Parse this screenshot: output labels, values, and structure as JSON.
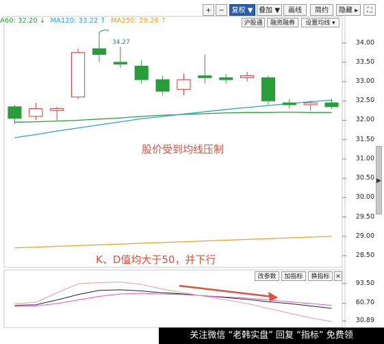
{
  "toolbar": {
    "plus": "+",
    "minus": "−",
    "fq": "复权 ▼",
    "add": "叠加 ▼",
    "draw": "画线",
    "simple": "简约",
    "hide": "隐藏 ▸",
    "expand": "⛶"
  },
  "legend": {
    "ma60": "A60: 32.20 ↓",
    "ma120": "MA120: 33.22 ↑",
    "ma250": "MA250: 29.26 ↑"
  },
  "sub_toolbar": {
    "hgt": "沪股通",
    "margin": "融资融券",
    "set_ma": "设置均线 ▾",
    "change_param": "改参数",
    "add_ind": "加指标",
    "switch_ind": "换指标",
    "close": "✕"
  },
  "annotations": {
    "price_note": "股价受到均线压制",
    "kd_note": "K、D值均大于50，并下行",
    "high_label": "34.27"
  },
  "watermark": "关注微信 “老韩实盘” 回复 “指标” 免费领",
  "colors": {
    "ma60": "#2a9d3b",
    "ma120": "#2aa0d8",
    "ma250": "#f0a020",
    "down_candle": "#2a9d3b",
    "up_candle": "#d83a3a",
    "annotation": "#e0503a"
  },
  "chart_data": [
    {
      "type": "candlestick",
      "y_ticks": [
        "34.00",
        "33.50",
        "33.00",
        "32.50",
        "32.00",
        "31.50",
        "31.00",
        "30.50",
        "30.00",
        "29.50",
        "29.00",
        "28.50"
      ],
      "ylim": [
        28.2,
        34.4
      ],
      "candles": [
        {
          "o": 32.35,
          "c": 32.05,
          "h": 32.4,
          "l": 31.9
        },
        {
          "o": 32.1,
          "c": 32.3,
          "h": 32.45,
          "l": 32.0
        },
        {
          "o": 32.25,
          "c": 32.3,
          "h": 32.35,
          "l": 32.0
        },
        {
          "o": 32.6,
          "c": 33.75,
          "h": 33.85,
          "l": 32.55
        },
        {
          "o": 33.85,
          "c": 33.7,
          "h": 34.27,
          "l": 33.5
        },
        {
          "o": 33.5,
          "c": 33.45,
          "h": 33.9,
          "l": 33.35
        },
        {
          "o": 33.4,
          "c": 33.05,
          "h": 33.55,
          "l": 32.95
        },
        {
          "o": 33.05,
          "c": 32.75,
          "h": 33.15,
          "l": 32.65
        },
        {
          "o": 32.8,
          "c": 33.05,
          "h": 33.2,
          "l": 32.65
        },
        {
          "o": 33.15,
          "c": 33.1,
          "h": 33.7,
          "l": 32.95
        },
        {
          "o": 33.1,
          "c": 33.05,
          "h": 33.2,
          "l": 32.95
        },
        {
          "o": 33.1,
          "c": 33.15,
          "h": 33.25,
          "l": 33.0
        },
        {
          "o": 33.1,
          "c": 32.5,
          "h": 33.15,
          "l": 32.4
        },
        {
          "o": 32.45,
          "c": 32.4,
          "h": 32.55,
          "l": 32.3
        },
        {
          "o": 32.4,
          "c": 32.45,
          "h": 32.5,
          "l": 32.25
        },
        {
          "o": 32.45,
          "c": 32.35,
          "h": 32.55,
          "l": 32.3
        }
      ],
      "series": [
        {
          "name": "MA60",
          "values": [
            31.95,
            31.96,
            31.98,
            32.0,
            32.03,
            32.06,
            32.1,
            32.13,
            32.15,
            32.17,
            32.19,
            32.2,
            32.2,
            32.21,
            32.2,
            32.2
          ]
        },
        {
          "name": "MA120",
          "values": [
            31.55,
            31.63,
            31.72,
            31.8,
            31.88,
            31.96,
            32.04,
            32.1,
            32.16,
            32.22,
            32.28,
            32.33,
            32.38,
            32.43,
            32.48,
            32.52
          ]
        },
        {
          "name": "MA250",
          "values": [
            28.7,
            28.72,
            28.74,
            28.76,
            28.78,
            28.8,
            28.82,
            28.84,
            28.86,
            28.88,
            28.9,
            28.92,
            28.94,
            28.96,
            28.98,
            29.0
          ]
        }
      ]
    },
    {
      "type": "line",
      "y_ticks": [
        "93.50",
        "60.70",
        "30.89"
      ],
      "ylim": [
        20,
        100
      ],
      "series": [
        {
          "name": "K",
          "values": [
            57,
            58,
            66,
            75,
            82,
            83,
            81,
            78,
            76,
            73,
            70,
            67,
            63,
            60,
            56,
            52
          ]
        },
        {
          "name": "D",
          "values": [
            55,
            56,
            60,
            66,
            72,
            76,
            77,
            76,
            75,
            73,
            71,
            69,
            66,
            63,
            60,
            57
          ]
        },
        {
          "name": "J",
          "values": [
            60,
            62,
            78,
            93,
            95,
            96,
            92,
            84,
            78,
            72,
            66,
            60,
            52,
            44,
            36,
            30
          ]
        }
      ]
    }
  ]
}
